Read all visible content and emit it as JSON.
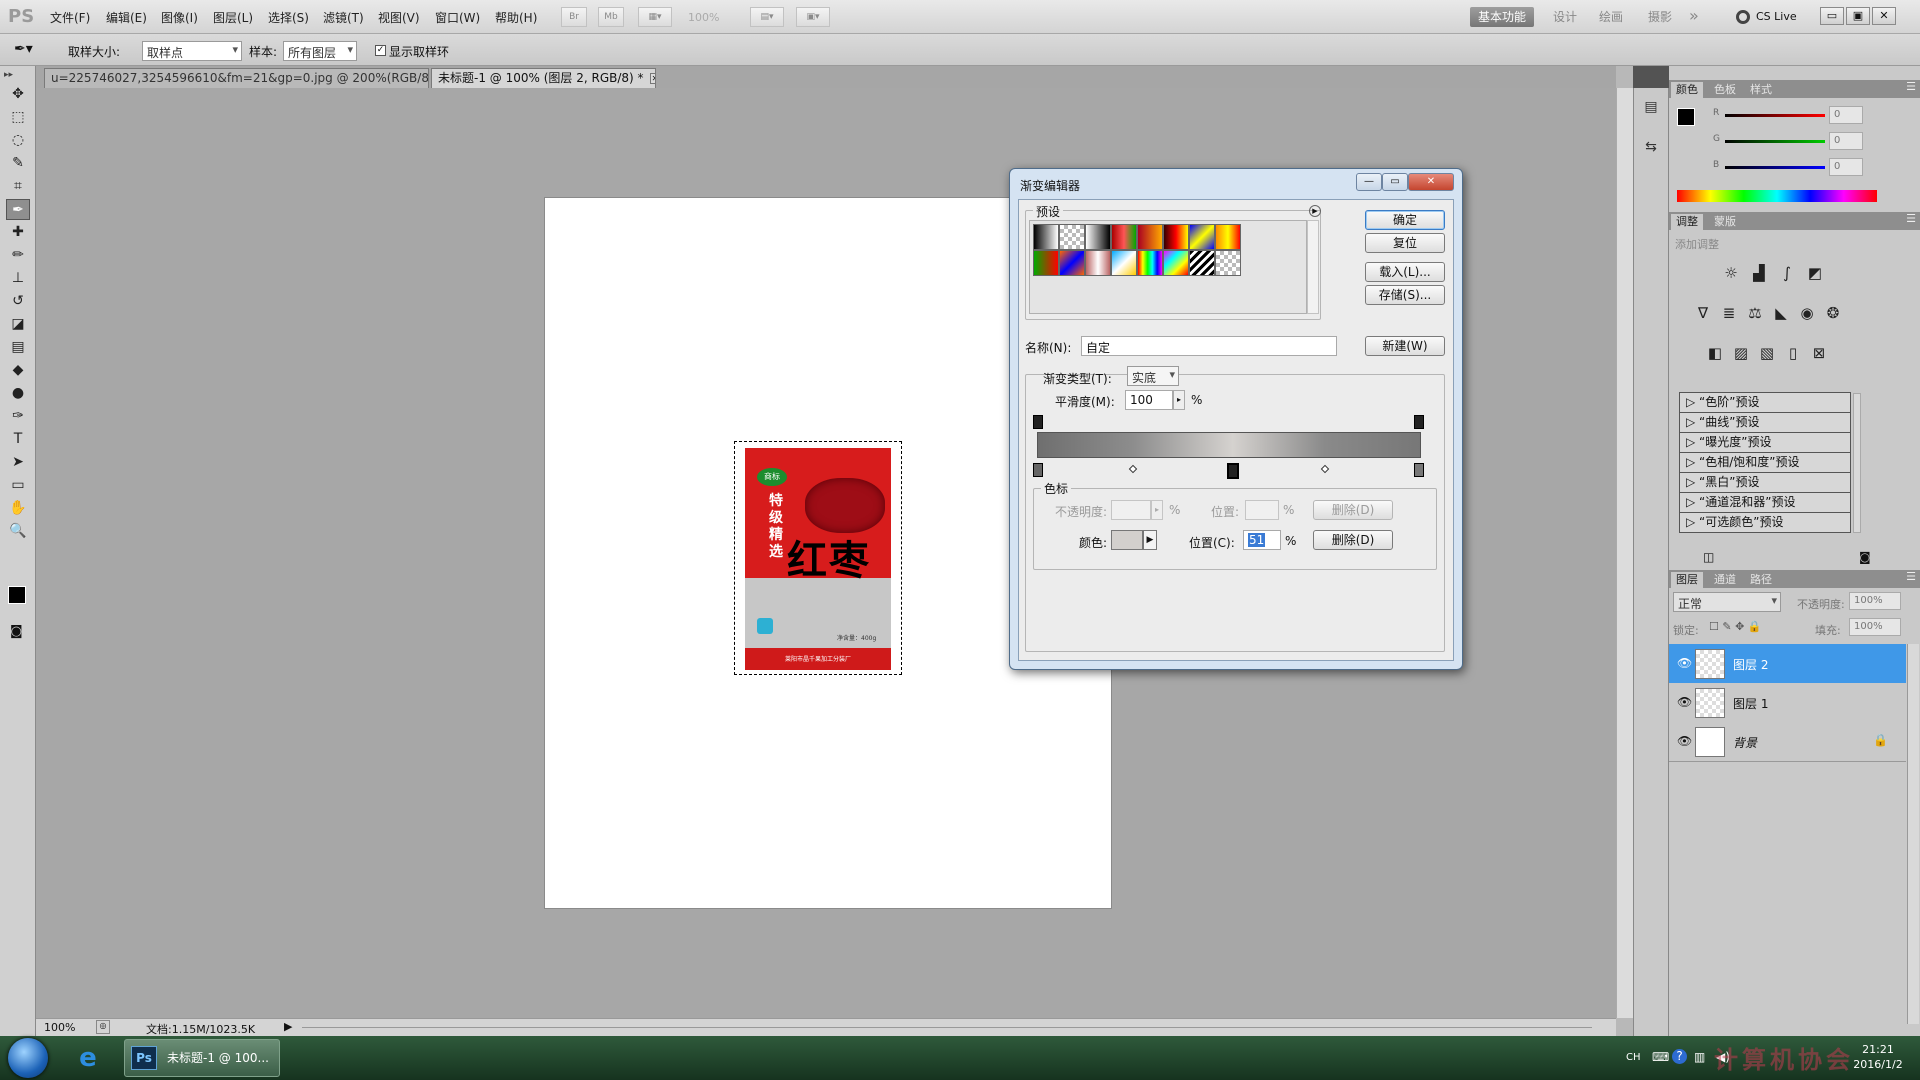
{
  "app": {
    "logo": "PS"
  },
  "menus": [
    {
      "label": "文件(F)"
    },
    {
      "label": "编辑(E)"
    },
    {
      "label": "图像(I)"
    },
    {
      "label": "图层(L)"
    },
    {
      "label": "选择(S)"
    },
    {
      "label": "滤镜(T)"
    },
    {
      "label": "视图(V)"
    },
    {
      "label": "窗口(W)"
    },
    {
      "label": "帮助(H)"
    }
  ],
  "appbar": {
    "br": "Br",
    "mb": "Mb",
    "zoom": "100%"
  },
  "workspaces": [
    {
      "label": "基本功能",
      "active": true
    },
    {
      "label": "设计",
      "active": false
    },
    {
      "label": "绘画",
      "active": false
    },
    {
      "label": "摄影",
      "active": false
    }
  ],
  "more_symbol": "»",
  "cslive": "CS Live",
  "window_controls": [
    "▭",
    "▣",
    "✕"
  ],
  "options": {
    "sample_size_label": "取样大小:",
    "sample_size_value": "取样点",
    "sample_label": "样本:",
    "sample_value": "所有图层",
    "show_ring_label": "显示取样环",
    "show_ring_checked": true
  },
  "tabs": [
    {
      "label": "u=225746027,3254596610&fm=21&gp=0.jpg @ 200%(RGB/8#)",
      "active": false
    },
    {
      "label": "未标题-1 @ 100% (图层 2, RGB/8) *",
      "active": true
    }
  ],
  "tools": [
    {
      "icon": "move-icon",
      "glyph": "✥"
    },
    {
      "icon": "marquee-icon",
      "glyph": "⬚"
    },
    {
      "icon": "lasso-icon",
      "glyph": "◌"
    },
    {
      "icon": "quick-select-icon",
      "glyph": "✎"
    },
    {
      "icon": "crop-icon",
      "glyph": "⌗"
    },
    {
      "icon": "eyedropper-icon",
      "glyph": "✒"
    },
    {
      "icon": "healing-icon",
      "glyph": "✚"
    },
    {
      "icon": "brush-icon",
      "glyph": "✏"
    },
    {
      "icon": "stamp-icon",
      "glyph": "⊥"
    },
    {
      "icon": "history-brush-icon",
      "glyph": "↺"
    },
    {
      "icon": "eraser-icon",
      "glyph": "◪"
    },
    {
      "icon": "gradient-icon",
      "glyph": "▤"
    },
    {
      "icon": "blur-icon",
      "glyph": "◆"
    },
    {
      "icon": "dodge-icon",
      "glyph": "●"
    },
    {
      "icon": "pen-icon",
      "glyph": "✑"
    },
    {
      "icon": "type-icon",
      "glyph": "T"
    },
    {
      "icon": "path-select-icon",
      "glyph": "➤"
    },
    {
      "icon": "shape-icon",
      "glyph": "▭"
    },
    {
      "icon": "hand-icon",
      "glyph": "✋"
    },
    {
      "icon": "zoom-icon",
      "glyph": "🔍"
    }
  ],
  "status": {
    "zoom": "100%",
    "doc": "文档:1.15M/1023.5K"
  },
  "image_text": {
    "badge": "商标",
    "vertical": "特级精选",
    "big": "红枣",
    "net": "净含量：400g",
    "manufacturer": "莱阳市晶千果加工分装厂"
  },
  "color_panel": {
    "tabs": [
      "颜色",
      "色板",
      "样式"
    ],
    "r_label": "R",
    "g_label": "G",
    "b_label": "B",
    "r": "0",
    "g": "0",
    "b": "0"
  },
  "adjust_panel": {
    "tabs": [
      "调整",
      "蒙版"
    ],
    "title": "添加调整",
    "presets": [
      "“色阶”预设",
      "“曲线”预设",
      "“曝光度”预设",
      "“色相/饱和度”预设",
      "“黑白”预设",
      "“通道混和器”预设",
      "“可选颜色”预设"
    ]
  },
  "layers_panel": {
    "tabs": [
      "图层",
      "通道",
      "路径"
    ],
    "blend_mode": "正常",
    "opacity_label": "不透明度:",
    "opacity": "100%",
    "lock_label": "锁定:",
    "fill_label": "填充:",
    "fill": "100%",
    "layers": [
      {
        "name": "图层 2",
        "selected": true
      },
      {
        "name": "图层 1",
        "selected": false
      },
      {
        "name": "背景",
        "selected": false,
        "locked": true
      }
    ]
  },
  "dialog": {
    "title": "渐变编辑器",
    "presets_label": "预设",
    "ok": "确定",
    "reset": "复位",
    "load": "载入(L)...",
    "save": "存储(S)...",
    "name_label": "名称(N):",
    "name_value": "自定",
    "new": "新建(W)",
    "type_label": "渐变类型(T):",
    "type_value": "实底",
    "smooth_label": "平滑度(M):",
    "smooth_value": "100",
    "percent": "%",
    "stops_label": "色标",
    "opacity_label": "不透明度:",
    "opacity_pct": "%",
    "position_label": "位置:",
    "position_pct": "%",
    "delete_d": "删除(D)",
    "color_label": "颜色:",
    "position_c_label": "位置(C):",
    "position_c_value": "51",
    "position_c_pct": "%",
    "delete_d2": "删除(D)"
  },
  "taskbar": {
    "task_label": "未标题-1 @ 100...",
    "ps_icon": "Ps",
    "ie_icon": "e",
    "tray_lang": "CH",
    "time": "21:21",
    "date": "2016/1/2"
  },
  "watermark": "计算机协会"
}
